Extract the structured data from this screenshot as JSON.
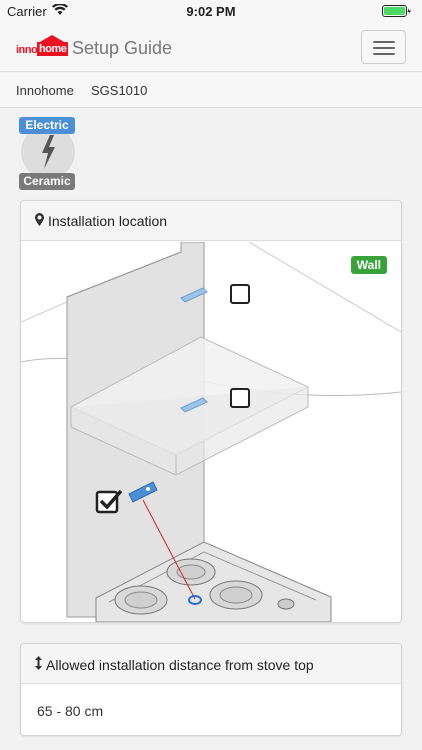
{
  "status_bar": {
    "carrier": "Carrier",
    "time": "9:02 PM"
  },
  "header": {
    "logo_inno": "inno",
    "logo_home": "home",
    "title": "Setup Guide",
    "menu_icon": "hamburger-icon"
  },
  "breadcrumb": {
    "items": [
      "Innohome",
      "SGS1010"
    ]
  },
  "stove_type": {
    "top_label": "Electric",
    "bottom_label": "Ceramic",
    "icon": "lightning-bolt-icon"
  },
  "location_card": {
    "title": "Installation location",
    "icon": "map-marker-icon",
    "wall_label": "Wall",
    "positions": [
      {
        "name": "upper",
        "checked": false
      },
      {
        "name": "middle",
        "checked": false
      },
      {
        "name": "lower",
        "checked": true
      }
    ]
  },
  "distance_card": {
    "title": "Allowed installation distance from stove top",
    "icon": "vertical-arrows-icon",
    "value": "65 - 80 cm"
  },
  "colors": {
    "accent_blue": "#4a8fd8",
    "wall_green": "#3aa23a",
    "brand_red": "#e12",
    "laser_red": "#d22"
  }
}
